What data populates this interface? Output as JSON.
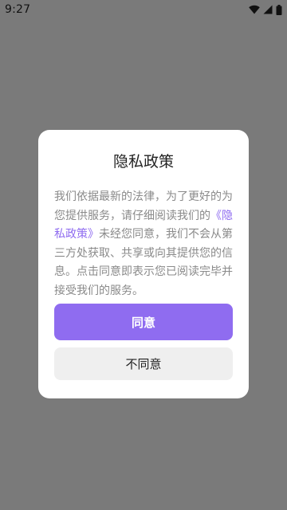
{
  "status_bar": {
    "time": "9:27",
    "icons": [
      "wifi-icon",
      "signal-icon",
      "battery-icon"
    ]
  },
  "dialog": {
    "title": "隐私政策",
    "body_before": "我们依据最新的法律，为了更好的为您提供服务，请仔细阅读我们的",
    "policy_link": "《隐私政策》",
    "body_after": "未经您同意，我们不会从第三方处获取、共享或向其提供您的信息。点击同意即表示您已阅读完毕并接受我们的服务。",
    "agree_label": "同意",
    "disagree_label": "不同意"
  },
  "colors": {
    "overlay": "#7a7a7a",
    "accent": "#8f6cf0",
    "dialog_bg": "#ffffff",
    "secondary_button_bg": "#efefef",
    "body_text": "#8a8a8a"
  }
}
